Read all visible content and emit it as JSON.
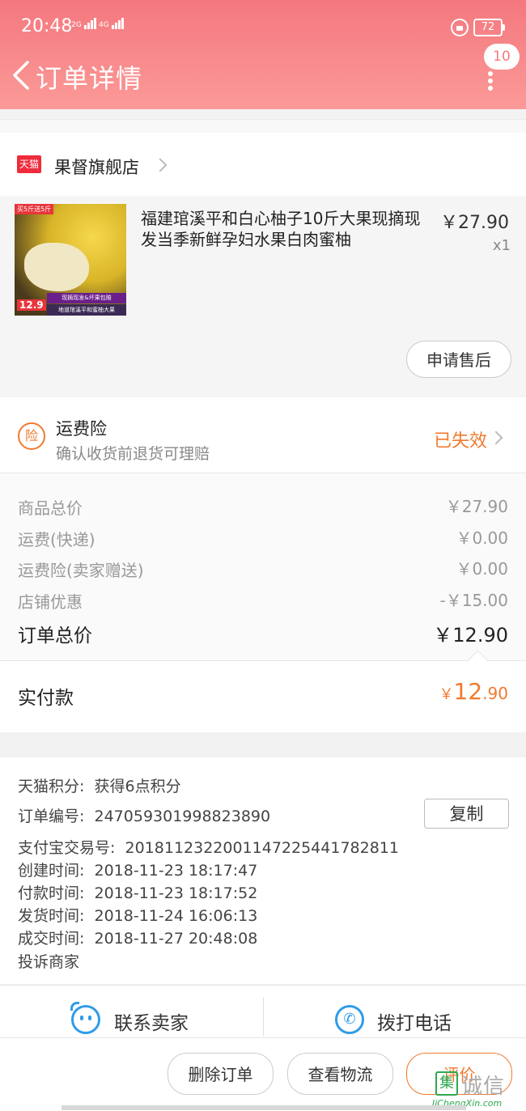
{
  "status_bar": {
    "time": "20:48",
    "sig1": "2G",
    "sig2": "4G",
    "battery": "72"
  },
  "nav": {
    "title": "订单详情",
    "badge": "10"
  },
  "store": {
    "tmall_label": "天猫",
    "name": "果督旗舰店"
  },
  "product": {
    "title": "福建琯溪平和白心柚子10斤大果现摘现发当季新鲜孕妇水果白肉蜜柚",
    "price": "￥27.90",
    "qty": "x1",
    "thumb_tag": "买5斤送5斤",
    "thumb_price": "12.9",
    "thumb_strip1": "现摘现发&坏果包赔",
    "thumb_strip2": "地道琯溪平和蜜柚大果",
    "after_sale_button": "申请售后"
  },
  "insurance": {
    "icon_char": "险",
    "title": "运费险",
    "subtitle": "确认收货前退货可理赔",
    "status": "已失效"
  },
  "costs": [
    {
      "label": "商品总价",
      "value": "￥27.90"
    },
    {
      "label": "运费(快递)",
      "value": "￥0.00"
    },
    {
      "label": "运费险(卖家赠送)",
      "value": "￥0.00"
    },
    {
      "label": "店铺优惠",
      "value": "-￥15.00"
    }
  ],
  "total": {
    "label": "订单总价",
    "value": "￥12.90"
  },
  "paid": {
    "label": "实付款",
    "currency": "￥",
    "integer": "12",
    "decimal": ".90"
  },
  "info": {
    "points": {
      "label": "天猫积分:",
      "value": "获得6点积分"
    },
    "order_no": {
      "label": "订单编号:",
      "value": "247059301998823890"
    },
    "copy_button": "复制",
    "alipay_no": {
      "label": "支付宝交易号:",
      "value": "2018112322001147225441782811"
    },
    "created": {
      "label": "创建时间:",
      "value": "2018-11-23 18:17:47"
    },
    "paid_time": {
      "label": "付款时间:",
      "value": "2018-11-23 18:17:52"
    },
    "shipped": {
      "label": "发货时间:",
      "value": "2018-11-24 16:06:13"
    },
    "completed": {
      "label": "成交时间:",
      "value": "2018-11-27 20:48:08"
    },
    "complain": "投诉商家"
  },
  "contact": {
    "seller": "联系卖家",
    "phone": "拨打电话"
  },
  "actions": {
    "delete": "删除订单",
    "logistics": "查看物流",
    "review": "评价"
  },
  "watermark": {
    "mark": "集",
    "text": "诚信",
    "url": "JiChengXin.com"
  },
  "colors": {
    "header_top": "#f4787e",
    "accent_orange": "#f07a2e",
    "link_blue": "#2f9ce8",
    "tmall_red": "#ef2b3c"
  }
}
